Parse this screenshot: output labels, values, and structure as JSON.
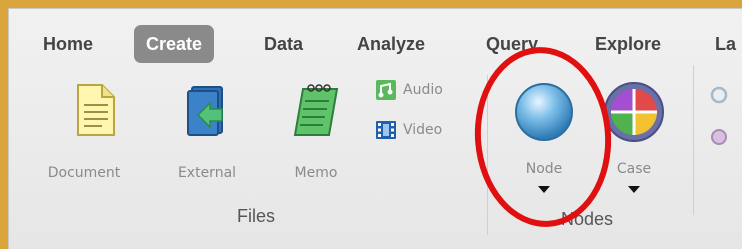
{
  "tabs": [
    {
      "label": "Home",
      "active": false
    },
    {
      "label": "Create",
      "active": true
    },
    {
      "label": "Data",
      "active": false
    },
    {
      "label": "Analyze",
      "active": false
    },
    {
      "label": "Query",
      "active": false
    },
    {
      "label": "Explore",
      "active": false
    },
    {
      "label": "La",
      "active": false
    }
  ],
  "files_group": {
    "label": "Files",
    "document_label": "Document",
    "external_label": "External",
    "memo_label": "Memo",
    "audio_label": "Audio",
    "video_label": "Video"
  },
  "nodes_group": {
    "label": "Nodes",
    "node_label": "Node",
    "case_label": "Case"
  },
  "colors": {
    "window_border": "#d9a43a",
    "active_tab": "#8a8a8a",
    "annotation": "#e01010"
  },
  "icons": [
    "document-icon",
    "external-icon",
    "memo-icon",
    "audio-icon",
    "video-icon",
    "node-icon",
    "case-icon"
  ]
}
